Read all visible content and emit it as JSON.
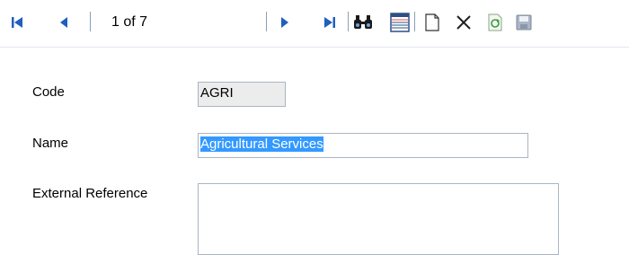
{
  "toolbar": {
    "record_position": "1 of 7",
    "icons": [
      "first-record-icon",
      "previous-record-icon",
      "next-record-icon",
      "last-record-icon",
      "find-icon",
      "list-view-icon",
      "new-record-icon",
      "delete-icon",
      "copy-record-icon",
      "save-icon"
    ]
  },
  "form": {
    "code_label": "Code",
    "code_value": "AGRI",
    "name_label": "Name",
    "name_value": "Agricultural Services",
    "external_reference_label": "External Reference",
    "external_reference_value": ""
  },
  "colors": {
    "accent": "#1f5fbf",
    "selection": "#3399ff"
  }
}
